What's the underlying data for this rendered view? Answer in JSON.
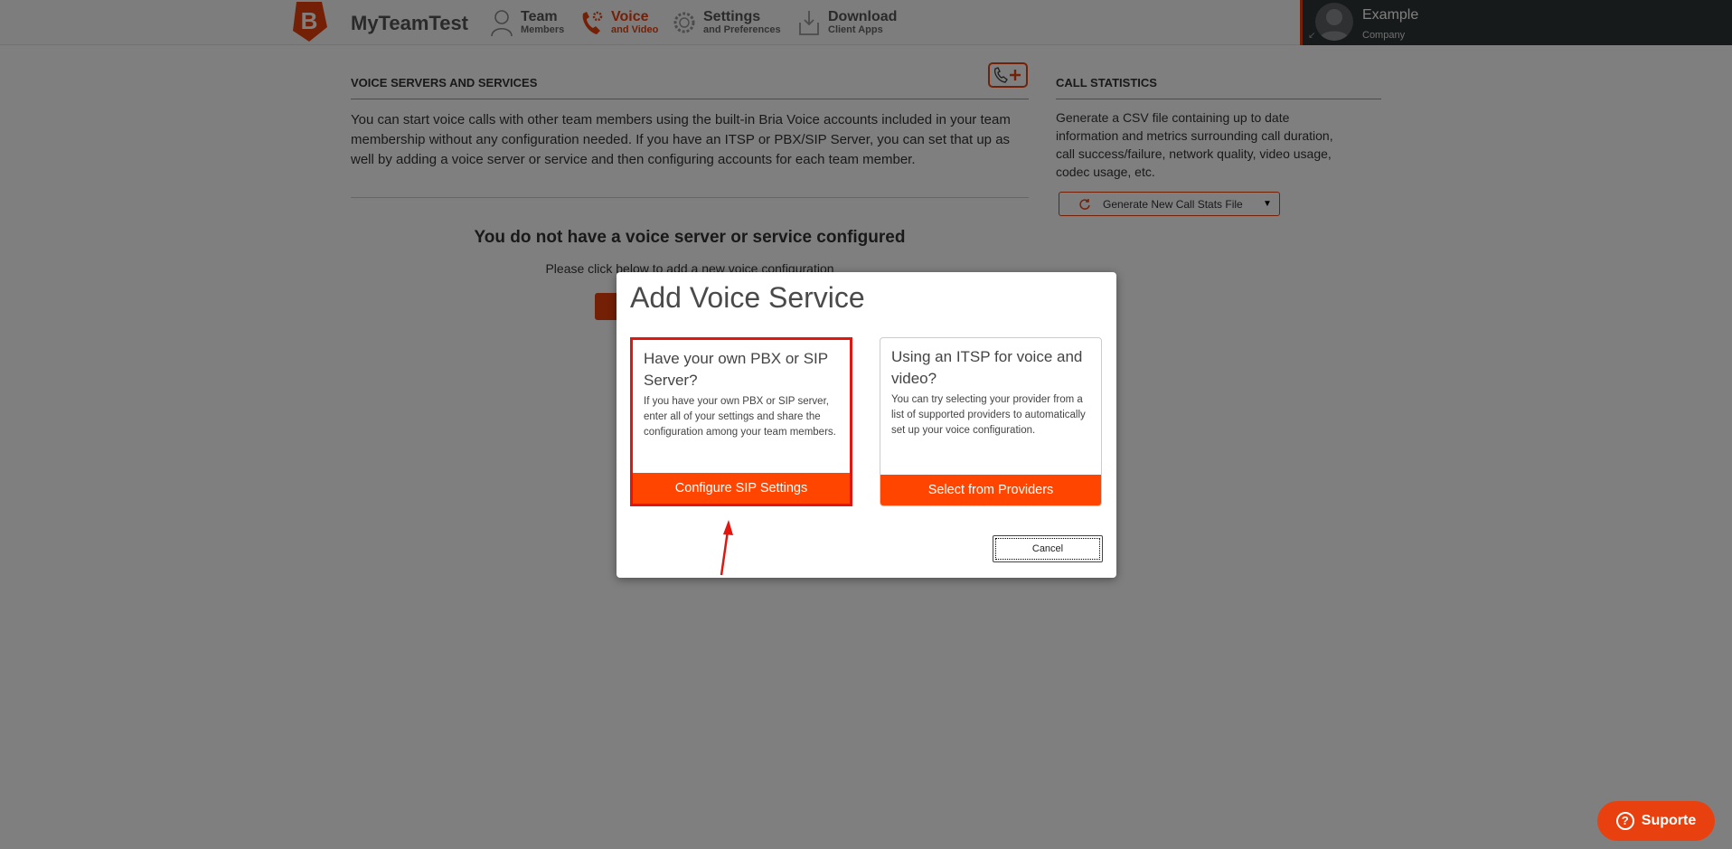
{
  "app": {
    "title": "MyTeamTest"
  },
  "nav": [
    {
      "main": "Team",
      "sub": "Members",
      "icon": "person-icon"
    },
    {
      "main": "Voice",
      "sub": "and Video",
      "icon": "phone-gear-icon",
      "active": true
    },
    {
      "main": "Settings",
      "sub": "and Preferences",
      "icon": "gear-icon"
    },
    {
      "main": "Download",
      "sub": "Client Apps",
      "icon": "download-icon"
    }
  ],
  "user": {
    "name": "Example",
    "company": "Company"
  },
  "voice": {
    "section_title": "VOICE SERVERS AND SERVICES",
    "description": "You can start voice calls with other team members using the built-in Bria Voice accounts included in your team membership without any configuration needed. If you have an ITSP or PBX/SIP Server, you can set that up as well by adding a voice server or service and then configuring accounts for each team member.",
    "empty_title": "You do not have a voice server or service configured",
    "empty_sub": "Please click below to add a new voice configuration"
  },
  "stats": {
    "section_title": "CALL STATISTICS",
    "description": "Generate a CSV file containing up to date information and metrics surrounding call duration, call success/failure, network quality, video usage, codec usage, etc.",
    "generate_label": "Generate New Call Stats File"
  },
  "modal": {
    "title": "Add Voice Service",
    "options": [
      {
        "heading": "Have your own PBX or SIP Server?",
        "description": "If you have your own PBX or SIP server, enter all of your settings and share the configuration among your team members.",
        "button": "Configure SIP Settings",
        "selected": true
      },
      {
        "heading": "Using an ITSP for voice and video?",
        "description": "You can try selecting your provider from a list of supported providers to automatically set up your voice configuration.",
        "button": "Select from Providers",
        "selected": false
      }
    ],
    "cancel_label": "Cancel"
  },
  "support": {
    "label": "Suporte"
  },
  "colors": {
    "accent": "#e8410f",
    "button": "#ff4500",
    "highlight": "#e3150e"
  }
}
